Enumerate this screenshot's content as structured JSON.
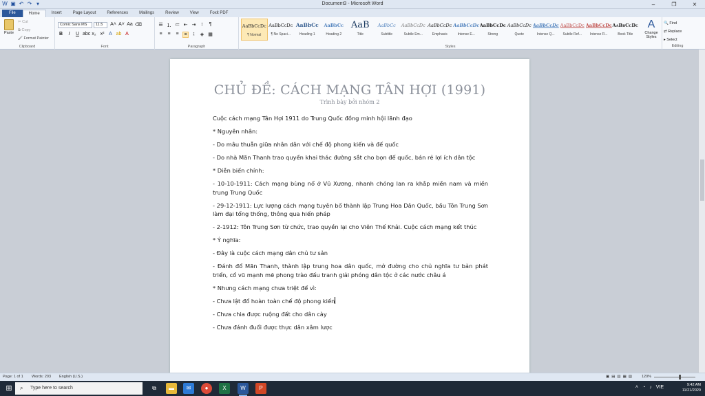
{
  "window": {
    "title": "Document3 - Microsoft Word",
    "controls": [
      "–",
      "❐",
      "✕"
    ]
  },
  "qat_icons": [
    "word-icon",
    "save-icon",
    "undo-icon",
    "redo-icon",
    "customize-icon"
  ],
  "tabs": [
    {
      "label": "File"
    },
    {
      "label": "Home"
    },
    {
      "label": "Insert"
    },
    {
      "label": "Page Layout"
    },
    {
      "label": "References"
    },
    {
      "label": "Mailings"
    },
    {
      "label": "Review"
    },
    {
      "label": "View"
    },
    {
      "label": "Foxit PDF"
    }
  ],
  "ribbon": {
    "clipboard": {
      "paste": "Paste",
      "cut": "Cut",
      "copy": "Copy",
      "format_painter": "Format Painter",
      "label": "Clipboard"
    },
    "font": {
      "family": "Comic Sans MS",
      "size": "11.5",
      "label": "Font"
    },
    "paragraph": {
      "label": "Paragraph"
    },
    "styles": {
      "label": "Styles",
      "items": [
        {
          "sample": "AaBbCcDc",
          "name": "¶ Normal"
        },
        {
          "sample": "AaBbCcDc",
          "name": "¶ No Spaci..."
        },
        {
          "sample": "AaBbCc",
          "name": "Heading 1"
        },
        {
          "sample": "AaBbCc",
          "name": "Heading 2"
        },
        {
          "sample": "AaB",
          "name": "Title"
        },
        {
          "sample": "AaBbCc",
          "name": "Subtitle"
        },
        {
          "sample": "AaBbCcDc",
          "name": "Subtle Em..."
        },
        {
          "sample": "AaBbCcDc",
          "name": "Emphasis"
        },
        {
          "sample": "AaBbCcDc",
          "name": "Intense E..."
        },
        {
          "sample": "AaBbCcDc",
          "name": "Strong"
        },
        {
          "sample": "AaBbCcDc",
          "name": "Quote"
        },
        {
          "sample": "AaBbCcDc",
          "name": "Intense Q..."
        },
        {
          "sample": "AaBbCcDc",
          "name": "Subtle Ref..."
        },
        {
          "sample": "AaBbCcDc",
          "name": "Intense R..."
        },
        {
          "sample": "AaBbCcDc",
          "name": "Book Title"
        }
      ],
      "change_styles": "Change Styles"
    },
    "editing": {
      "find": "Find",
      "replace": "Replace",
      "select": "Select",
      "label": "Editing"
    }
  },
  "document": {
    "title": "CHỦ ĐỀ: CÁCH MẠNG TÂN HỢI (1991)",
    "subtitle": "Trình bày bởi nhóm 2",
    "paragraphs": [
      "Cuộc cách mạng Tân Hợi 1911 do Trung Quốc đồng minh hội lãnh đạo",
      "* Nguyên nhân:",
      "- Do mâu thuẫn giữa nhân dân với chế độ phong kiến và đế quốc",
      "- Do nhà Mãn Thanh trao quyền khai thác đường sắt cho bọn đế quốc, bán rẻ lợi ích dân tộc",
      "* Diễn biến chính:",
      "- 10-10-1911: Cách mạng bùng nổ ở Vũ Xương, nhanh chóng lan ra khắp miền nam và miền trung Trung Quốc",
      "- 29-12-1911: Lực lượng cách mạng tuyên bố thành lập Trung Hoa Dân Quốc, bầu Tôn Trung Sơn làm đại tổng thống, thông qua hiến pháp",
      "- 2-1912: Tôn Trung Sơn từ chức, trao quyền lại cho Viên Thế Khải. Cuộc cách mạng kết thúc",
      "* Ý nghĩa:",
      "- Đây là cuộc cách mạng dân chủ tư sản",
      "- Đánh đổ Mãn Thanh, thành lập trung hoa dân quốc, mở đường cho chủ nghĩa tư bản phát triển, cổ vũ mạnh mẽ phong trào đấu tranh giải phóng dân tộc ở các nước châu á",
      "* Nhưng cách mạng chưa triệt để vì:",
      "- Chưa lật đổ hoàn toàn chế độ phong kiến",
      "- Chưa chia được ruộng đất cho dân cày",
      "- Chưa đánh đuổi được thực dân xâm lược"
    ]
  },
  "status": {
    "page": "Page: 1 of 1",
    "words": "Words: 203",
    "language": "English (U.S.)",
    "zoom": "120%"
  },
  "taskbar": {
    "search_placeholder": "Type here to search",
    "time": "9:42 AM",
    "date": "11/21/2020",
    "lang": "VIE"
  }
}
